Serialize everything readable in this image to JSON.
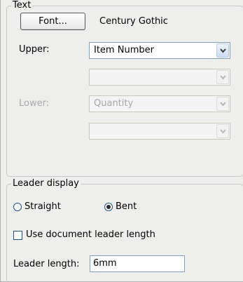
{
  "text_group": {
    "legend": "Text",
    "font_button_label": "Font...",
    "font_name": "Century Gothic",
    "upper": {
      "label": "Upper:",
      "primary_value": "Item Number",
      "secondary_value": ""
    },
    "lower": {
      "label": "Lower:",
      "primary_value": "Quantity",
      "secondary_value": ""
    }
  },
  "leader_group": {
    "legend": "Leader display",
    "radio_straight": {
      "label": "Straight",
      "selected": false
    },
    "radio_bent": {
      "label": "Bent",
      "selected": true
    },
    "use_doc_length": {
      "label": "Use document leader length",
      "checked": false
    },
    "leader_length": {
      "label": "Leader length:",
      "value": "6mm"
    }
  },
  "icons": {
    "dropdown": "chevron-down-icon"
  }
}
